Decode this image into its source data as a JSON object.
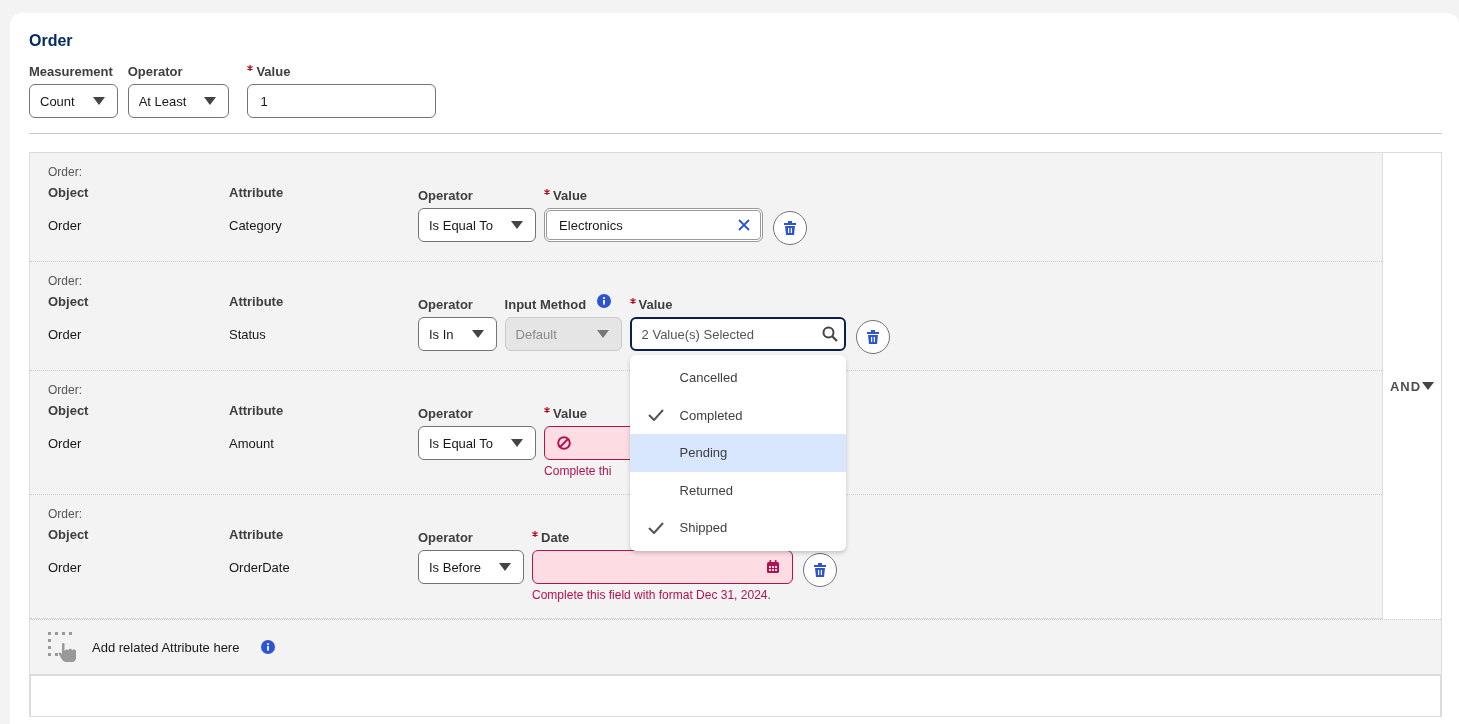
{
  "header": {
    "title": "Order",
    "fields": [
      {
        "kind": "select",
        "label": "Measurement",
        "required": false,
        "value": "Count"
      },
      {
        "kind": "select",
        "label": "Operator",
        "required": false,
        "value": "At Least"
      },
      {
        "kind": "text",
        "label": "Value",
        "required": true,
        "value": "1"
      }
    ]
  },
  "conditions": [
    {
      "group": "Order:",
      "object_label": "Object",
      "object": "Order",
      "attribute_label": "Attribute",
      "attribute": "Category",
      "fields": [
        {
          "kind": "select",
          "label": "Operator",
          "required": false,
          "value": "Is Equal To"
        },
        {
          "kind": "lookup",
          "label": "Value",
          "required": true,
          "value": "Electronics",
          "clearable": true
        }
      ]
    },
    {
      "group": "Order:",
      "object_label": "Object",
      "object": "Order",
      "attribute_label": "Attribute",
      "attribute": "Status",
      "fields": [
        {
          "kind": "select",
          "label": "Operator",
          "required": false,
          "value": "Is In"
        },
        {
          "kind": "select",
          "label": "Input Method",
          "required": false,
          "value": "Default",
          "info": true,
          "disabled": true
        },
        {
          "kind": "multiselect",
          "label": "Value",
          "required": true,
          "value": "2 Value(s) Selected",
          "focused": true,
          "options": [
            {
              "label": "Cancelled",
              "checked": false,
              "highlighted": false
            },
            {
              "label": "Completed",
              "checked": true,
              "highlighted": false
            },
            {
              "label": "Pending",
              "checked": false,
              "highlighted": true
            },
            {
              "label": "Returned",
              "checked": false,
              "highlighted": false
            },
            {
              "label": "Shipped",
              "checked": true,
              "highlighted": false
            }
          ]
        }
      ]
    },
    {
      "group": "Order:",
      "object_label": "Object",
      "object": "Order",
      "attribute_label": "Attribute",
      "attribute": "Amount",
      "fields": [
        {
          "kind": "select",
          "label": "Operator",
          "required": false,
          "value": "Is Equal To"
        },
        {
          "kind": "number",
          "label": "Value",
          "required": true,
          "invalid": true,
          "error": "Complete thi"
        }
      ]
    },
    {
      "group": "Order:",
      "object_label": "Object",
      "object": "Order",
      "attribute_label": "Attribute",
      "attribute": "OrderDate",
      "fields": [
        {
          "kind": "select",
          "label": "Operator",
          "required": false,
          "value": "Is Before"
        },
        {
          "kind": "date",
          "label": "Date",
          "required": true,
          "invalid": true,
          "error": "Complete this field with format Dec 31, 2024."
        }
      ]
    }
  ],
  "logic": "AND",
  "add_attribute": {
    "label": "Add related Attribute here",
    "info": true
  }
}
